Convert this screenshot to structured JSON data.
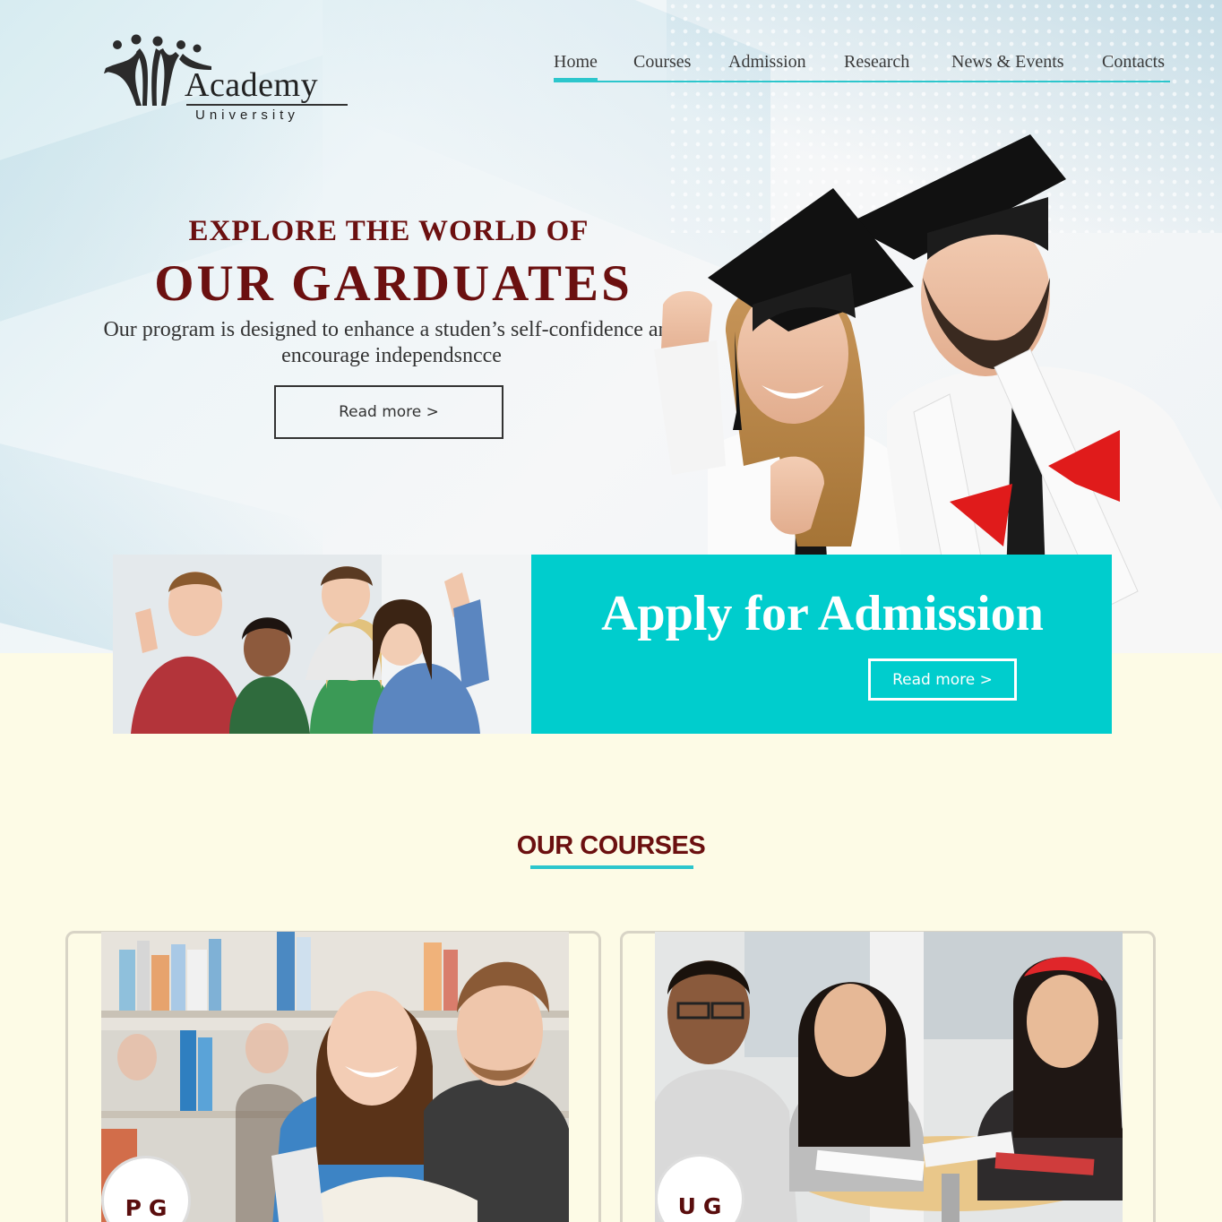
{
  "brand": {
    "name": "Academy",
    "tagline": "University"
  },
  "nav": {
    "items": [
      {
        "label": "Home",
        "active": true
      },
      {
        "label": "Courses",
        "active": false
      },
      {
        "label": "Admission",
        "active": false
      },
      {
        "label": "Research",
        "active": false
      },
      {
        "label": "News & Events",
        "active": false
      },
      {
        "label": "Contacts",
        "active": false
      }
    ]
  },
  "hero": {
    "kicker": "EXPLORE THE WORLD OF",
    "title": "OUR GARDUATES",
    "description": "Our program is designed to enhance a studen’s self-confidence and encourage independsncce",
    "button_label": "Read more >"
  },
  "admission": {
    "title": "Apply for Admission",
    "button_label": "Read more >"
  },
  "courses": {
    "heading": "OUR COURSES",
    "cards": [
      {
        "badge": "PG"
      },
      {
        "badge": "UG"
      }
    ]
  },
  "colors": {
    "accent_teal": "#00cdcd",
    "line_teal": "#2cc6cc",
    "maroon": "#6b1010",
    "page_bg": "#fdfbe6"
  }
}
